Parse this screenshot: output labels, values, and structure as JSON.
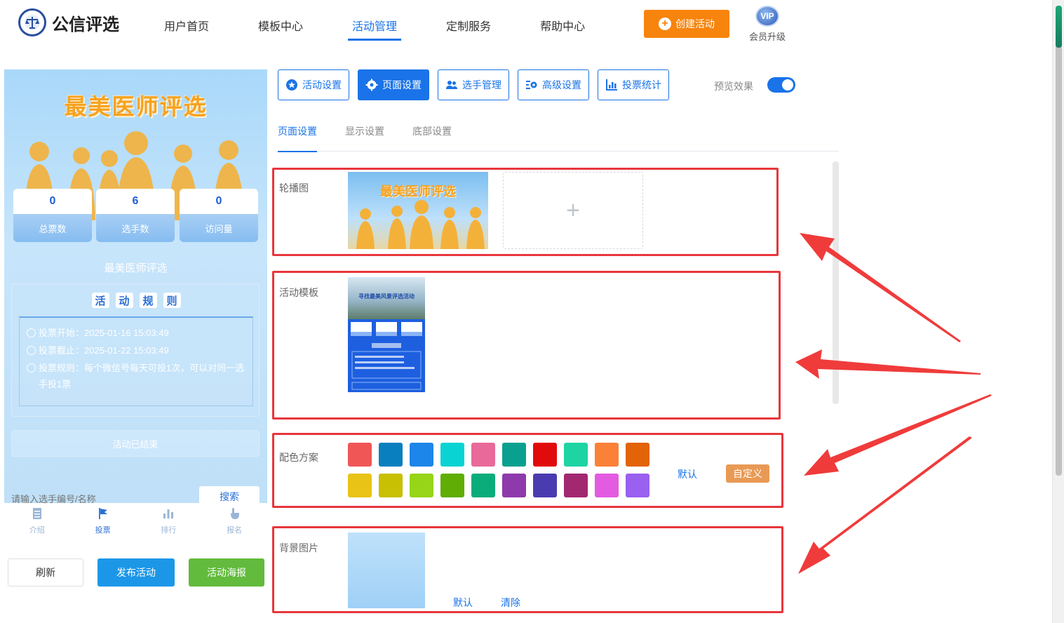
{
  "header": {
    "logo_text": "公信评选",
    "nav": [
      {
        "label": "用户首页"
      },
      {
        "label": "模板中心"
      },
      {
        "label": "活动管理"
      },
      {
        "label": "定制服务"
      },
      {
        "label": "帮助中心"
      }
    ],
    "active_nav": "活动管理",
    "create_label": "创建活动",
    "vip_badge": "VIP",
    "vip_label": "会员升级"
  },
  "preview": {
    "title": "最美医师评选",
    "stats": [
      {
        "value": "0",
        "label": "总票数"
      },
      {
        "value": "6",
        "label": "选手数"
      },
      {
        "value": "0",
        "label": "访问量"
      }
    ],
    "activity_name": "最美医师评选",
    "rules_heading": [
      "活",
      "动",
      "规",
      "则"
    ],
    "rules": [
      {
        "text": "投票开始：2025-01-16 15:03:49"
      },
      {
        "text": "投票截止：2025-01-22 15:03:49"
      },
      {
        "text": "投票规则：每个微信号每天可投1次，可以对同一选手投1票"
      }
    ],
    "ended_text": "活动已结束",
    "search_placeholder": "请输入选手编号/名称",
    "search_button": "搜索",
    "tabs": [
      {
        "label": "介绍",
        "icon": "document-icon"
      },
      {
        "label": "投票",
        "icon": "flag-icon"
      },
      {
        "label": "排行",
        "icon": "bar-chart-icon"
      },
      {
        "label": "报名",
        "icon": "hand-pointer-icon"
      }
    ],
    "active_tab": "投票"
  },
  "left_actions": {
    "refresh": "刷新",
    "publish": "发布活动",
    "poster": "活动海报"
  },
  "toolbar": {
    "buttons": [
      {
        "label": "活动设置",
        "icon": "star-icon"
      },
      {
        "label": "页面设置",
        "icon": "gear-icon"
      },
      {
        "label": "选手管理",
        "icon": "users-icon"
      },
      {
        "label": "高级设置",
        "icon": "settings-icon"
      },
      {
        "label": "投票统计",
        "icon": "stats-icon"
      }
    ],
    "active": "页面设置",
    "preview_label": "预览效果",
    "preview_on": true
  },
  "subtabs": {
    "items": [
      "页面设置",
      "显示设置",
      "底部设置"
    ],
    "active": "页面设置"
  },
  "sections": {
    "carousel": {
      "label": "轮播图",
      "image_title": "最美医师评选",
      "add_icon": "+"
    },
    "template": {
      "label": "活动模板",
      "thumb_title": "寻找最美风景评选活动"
    },
    "colors": {
      "label": "配色方案",
      "row1": [
        "#f05656",
        "#0a7fbf",
        "#1d86ea",
        "#0ad3d3",
        "#e8699a",
        "#09a08f",
        "#e20b0b",
        "#1dd4a2",
        "#fb8038",
        "#e26308"
      ],
      "row2": [
        "#e9c417",
        "#c8c003",
        "#96d518",
        "#60ad05",
        "#0aad7a",
        "#8e3aac",
        "#4a3cb0",
        "#a22870",
        "#e35be0",
        "#9a60f0"
      ],
      "default_label": "默认",
      "custom_label": "自定义"
    },
    "background": {
      "label": "背景图片",
      "default_label": "默认",
      "clear_label": "清除"
    }
  },
  "colors": {
    "primary": "#1a73e8",
    "orange": "#f7840c",
    "highlight_red": "#e8363c",
    "publish_blue": "#1c97e8",
    "poster_green": "#62bb3c"
  }
}
